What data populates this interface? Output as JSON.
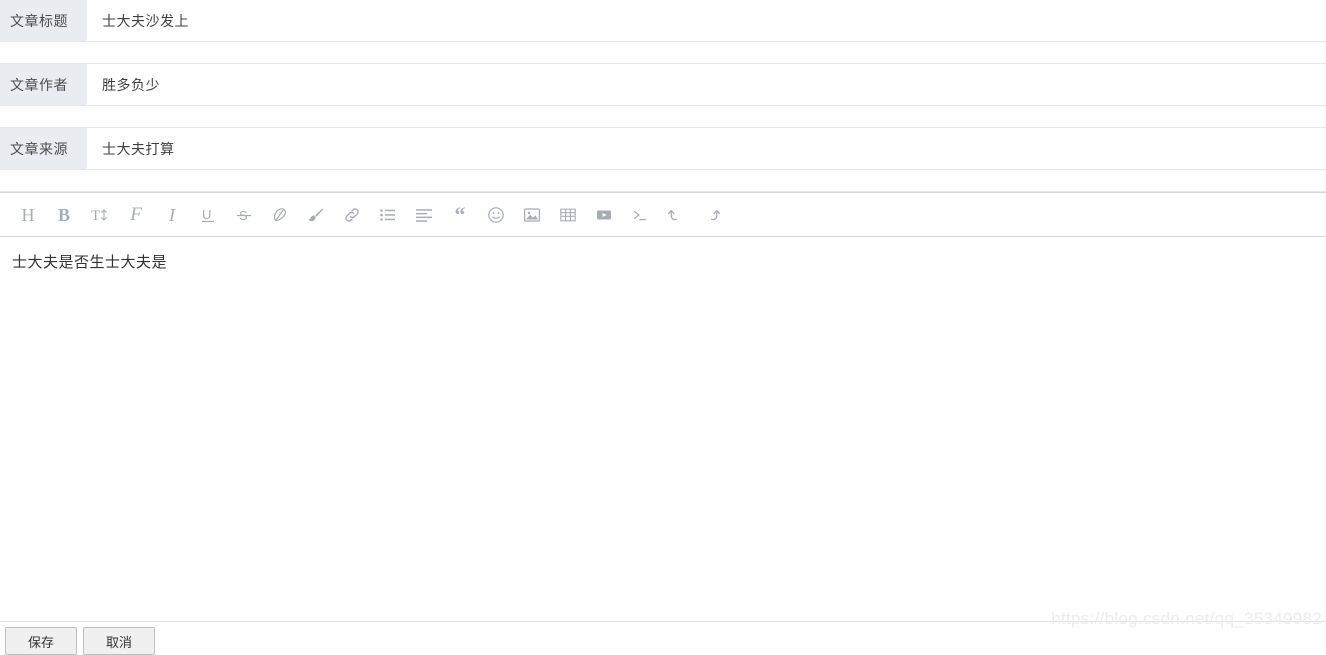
{
  "form": {
    "rows": [
      {
        "label": "文章标题",
        "value": "士大夫沙发上"
      },
      {
        "label": "文章作者",
        "value": "胜多负少"
      },
      {
        "label": "文章来源",
        "value": "士大夫打算"
      }
    ]
  },
  "editor": {
    "toolbar": [
      {
        "name": "heading-icon",
        "label": "H",
        "title": "标题"
      },
      {
        "name": "bold-icon",
        "label": "B",
        "title": "加粗"
      },
      {
        "name": "font-size-icon",
        "label": "T",
        "title": "字号"
      },
      {
        "name": "font-family-icon",
        "label": "F",
        "title": "字体"
      },
      {
        "name": "italic-icon",
        "label": "I",
        "title": "斜体"
      },
      {
        "name": "underline-icon",
        "label": "U",
        "title": "下划线"
      },
      {
        "name": "strikethrough-icon",
        "label": "S",
        "title": "删除线"
      },
      {
        "name": "highlight-pen-icon",
        "label": "",
        "title": "荧光笔"
      },
      {
        "name": "brush-icon",
        "label": "",
        "title": "背景色"
      },
      {
        "name": "link-icon",
        "label": "",
        "title": "链接"
      },
      {
        "name": "bullet-list-icon",
        "label": "",
        "title": "列表"
      },
      {
        "name": "align-icon",
        "label": "",
        "title": "对齐"
      },
      {
        "name": "quote-icon",
        "label": "",
        "title": "引用"
      },
      {
        "name": "emoji-icon",
        "label": "",
        "title": "表情"
      },
      {
        "name": "image-icon",
        "label": "",
        "title": "图片"
      },
      {
        "name": "table-icon",
        "label": "",
        "title": "表格"
      },
      {
        "name": "video-icon",
        "label": "",
        "title": "视频"
      },
      {
        "name": "code-icon",
        "label": "",
        "title": "代码"
      },
      {
        "name": "undo-icon",
        "label": "",
        "title": "撤销"
      },
      {
        "name": "redo-icon",
        "label": "",
        "title": "重做"
      }
    ],
    "content": "士大夫是否生士大夫是"
  },
  "footer": {
    "buttons": [
      {
        "label": "保存"
      },
      {
        "label": "取消"
      }
    ]
  },
  "watermark": "https://blog.csdn.net/qq_35349982",
  "colors": {
    "label_bg": "#e9edf1",
    "border": "#e6e6e6",
    "toolbar_border": "#d4d6d8",
    "icon": "#a7adb5",
    "text": "#3f3f3f",
    "watermark": "#ececec"
  }
}
